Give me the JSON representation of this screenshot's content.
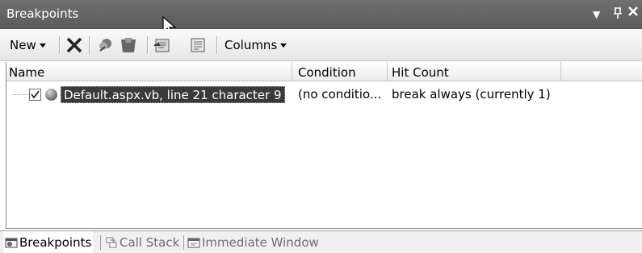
{
  "window": {
    "title": "Breakpoints",
    "dropdown_glyph": "▾",
    "pin_glyph": "ᚋ",
    "close_glyph": "✕"
  },
  "toolbar": {
    "new_label": "New",
    "delete_glyph": "✕",
    "columns_label": "Columns",
    "icons": [
      "delete-icon",
      "delete-all-icon",
      "disable-all-icon",
      "go-to-source-icon",
      "go-to-disassembly-icon"
    ]
  },
  "grid": {
    "columns": [
      "Name",
      "Condition",
      "Hit Count"
    ],
    "rows": [
      {
        "checked": "☑",
        "name": "Default.aspx.vb, line 21 character 9",
        "condition": "(no conditio...",
        "hit_count": "break always (currently 1)"
      }
    ]
  },
  "tabs": [
    {
      "label": "Breakpoints",
      "active": true
    },
    {
      "label": "Call Stack",
      "active": false
    },
    {
      "label": "Immediate Window",
      "active": false
    }
  ],
  "colors": {
    "titlebar": "#5f5f5f",
    "selection": "#3a3a3a"
  }
}
